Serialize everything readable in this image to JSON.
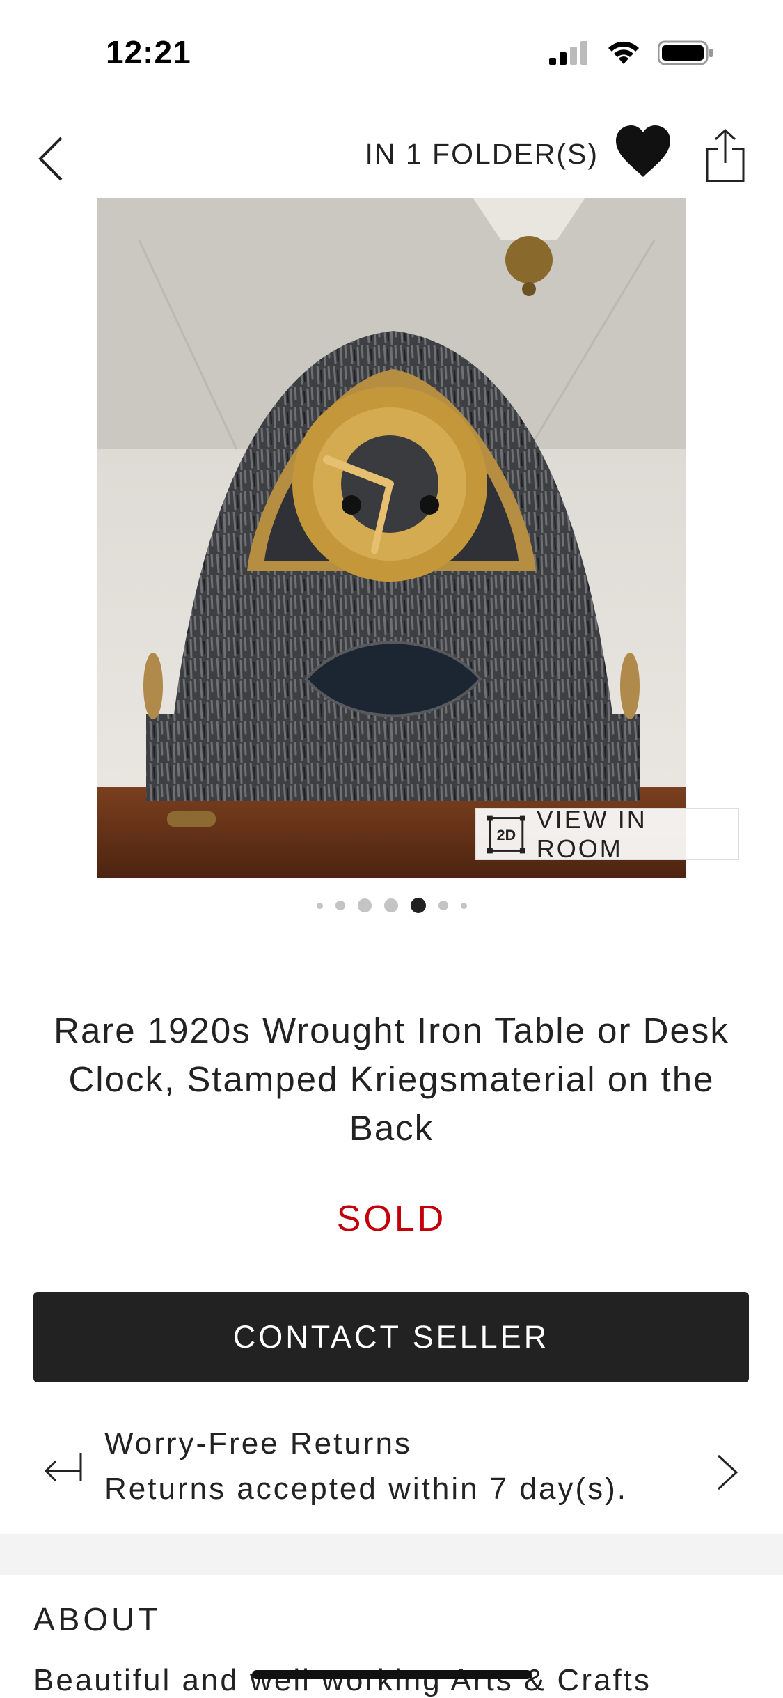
{
  "status_bar": {
    "time": "12:21"
  },
  "nav": {
    "folders_label": "IN 1 FOLDER(S)"
  },
  "gallery": {
    "view_in_room_badge": "2D",
    "view_in_room_label": "VIEW IN ROOM",
    "image_count": 7,
    "active_index": 4
  },
  "product": {
    "title": "Rare 1920s Wrought Iron Table or Desk Clock, Stamped Kriegsmaterial on the Back",
    "status": "SOLD"
  },
  "actions": {
    "contact_label": "CONTACT SELLER"
  },
  "returns": {
    "title": "Worry-Free Returns",
    "subtitle": "Returns accepted within 7 day(s)."
  },
  "about": {
    "heading": "ABOUT",
    "text": "Beautiful and well working Arts & Crafts"
  },
  "colors": {
    "sold": "#c2000b",
    "button": "#222222",
    "accent_brass": "#c4973b"
  },
  "icons": [
    "back-icon",
    "heart-icon",
    "share-icon",
    "returns-icon",
    "chevron-right-icon",
    "cube-icon"
  ]
}
